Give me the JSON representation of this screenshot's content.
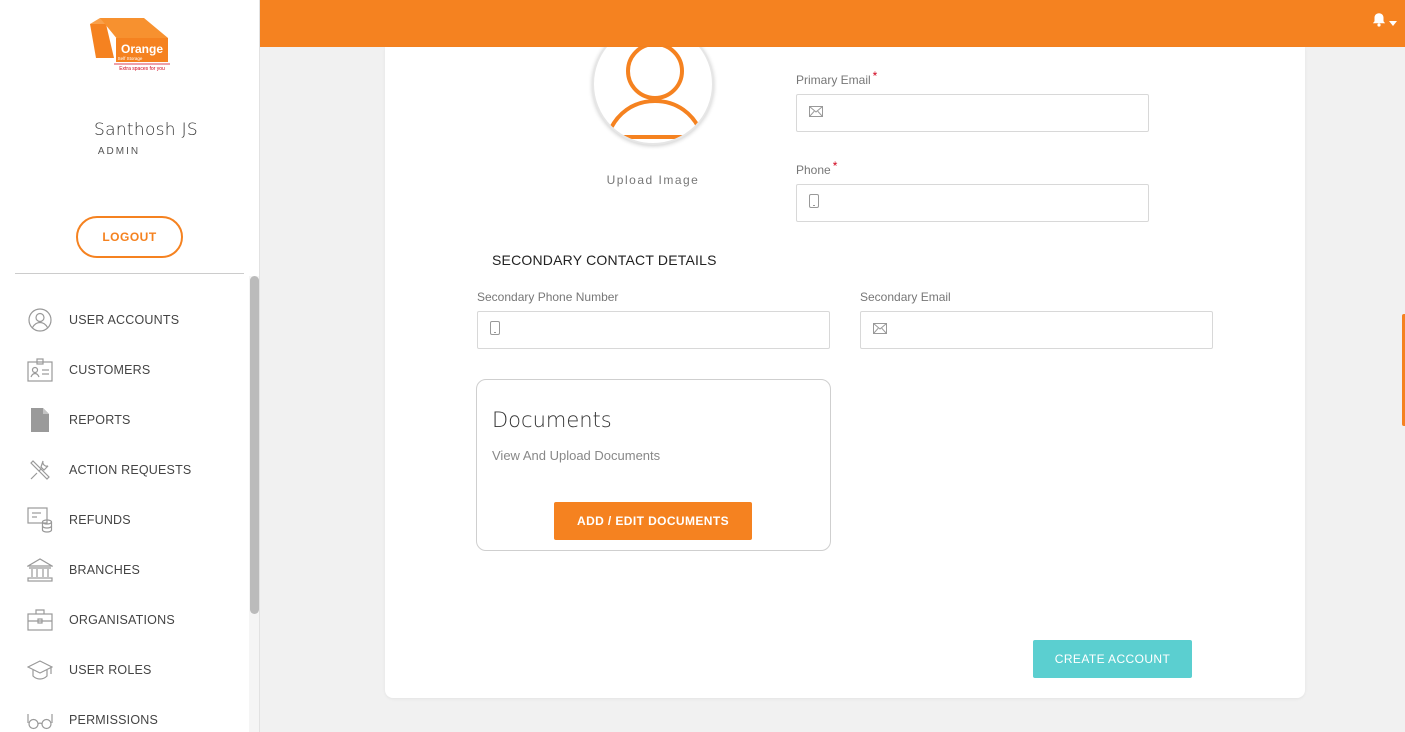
{
  "colors": {
    "brand_orange": "#f58220",
    "accent_teal": "#5bcfd0",
    "required_red": "#d0021b"
  },
  "logo": {
    "brand": "Orange",
    "tagline_line1": "Self Storage",
    "tagline_line2": "Extra spaces for you"
  },
  "user": {
    "name": "Santhosh JS",
    "role": "ADMIN",
    "logout_label": "LOGOUT"
  },
  "sidebar": {
    "items": [
      {
        "label": "USER ACCOUNTS",
        "icon": "user-circle-icon"
      },
      {
        "label": "CUSTOMERS",
        "icon": "id-card-icon"
      },
      {
        "label": "REPORTS",
        "icon": "document-icon"
      },
      {
        "label": "ACTION REQUESTS",
        "icon": "tools-icon"
      },
      {
        "label": "REFUNDS",
        "icon": "refund-icon"
      },
      {
        "label": "BRANCHES",
        "icon": "bank-icon"
      },
      {
        "label": "ORGANISATIONS",
        "icon": "briefcase-icon"
      },
      {
        "label": "USER ROLES",
        "icon": "graduation-cap-icon"
      },
      {
        "label": "PERMISSIONS",
        "icon": "glasses-icon"
      }
    ]
  },
  "header": {
    "notification_icon": "bell-icon"
  },
  "form": {
    "upload_image_label": "Upload Image",
    "primary_email": {
      "label": "Primary Email",
      "required_mark": "*",
      "value": "",
      "icon": "mail-icon"
    },
    "phone": {
      "label": "Phone",
      "required_mark": "*",
      "value": "",
      "icon": "mobile-icon"
    },
    "secondary_section_title": "SECONDARY CONTACT DETAILS",
    "secondary_phone": {
      "label": "Secondary Phone Number",
      "value": "",
      "icon": "mobile-icon"
    },
    "secondary_email": {
      "label": "Secondary Email",
      "value": "",
      "icon": "mail-icon"
    },
    "documents": {
      "title": "Documents",
      "subtitle": "View And Upload Documents",
      "button_label": "ADD / EDIT DOCUMENTS"
    },
    "create_button_label": "CREATE ACCOUNT"
  }
}
